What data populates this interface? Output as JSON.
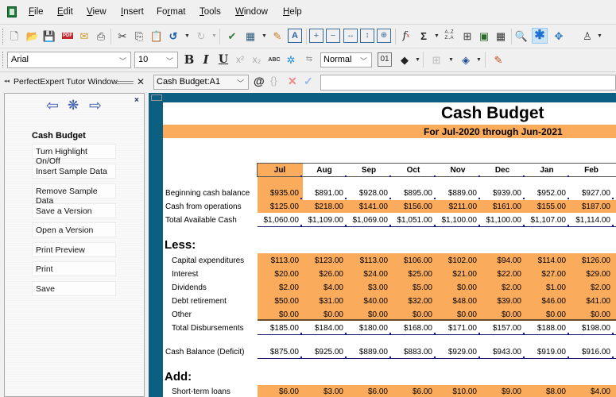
{
  "app": {
    "menu": [
      "File",
      "Edit",
      "View",
      "Insert",
      "Format",
      "Tools",
      "Window",
      "Help"
    ],
    "menu_mnemonic_index": [
      0,
      0,
      0,
      0,
      2,
      0,
      0,
      0
    ]
  },
  "toolbar1": {
    "icons": [
      "new-document-icon",
      "open-folder-icon",
      "save-icon",
      "pdf-icon",
      "email-icon",
      "print-icon",
      "cut-icon",
      "copy-icon",
      "paste-icon",
      "undo-icon",
      "redo-icon",
      "spellcheck-icon",
      "chart-icon",
      "fill-picture-icon",
      "text-box-icon",
      "insert-row-icon",
      "delete-row-icon",
      "column-width-icon",
      "row-height-icon",
      "fit-icon",
      "function-icon",
      "sum-icon",
      "sort-icon",
      "insert-table-icon",
      "grid-icon",
      "freeze-icon",
      "zoom-icon",
      "asterisk-icon",
      "navigate-icon",
      "outline-icon"
    ]
  },
  "toolbar2": {
    "font_name": "Arial",
    "font_size": "10",
    "bold": "B",
    "italic": "I",
    "underline": "U",
    "superscript": "x²",
    "subscript": "x₂",
    "style": "Normal"
  },
  "formula_bar": {
    "cell_ref": "Cash Budget:A1",
    "at_symbol": "@",
    "braces": "{}",
    "cancel": "✕",
    "accept": "✓",
    "formula_value": ""
  },
  "tutor": {
    "title": "PerfectExpert Tutor Window",
    "close": "×",
    "heading": "Cash Budget",
    "buttons": [
      "Turn Highlight On/Off",
      "Insert Sample Data",
      "Remove Sample Data",
      "Save a Version",
      "Open a Version",
      "Print Preview",
      "Print",
      "Save"
    ]
  },
  "sheet": {
    "title": "Cash Budget",
    "subtitle": "For Jul-2020 through Jun-2021",
    "months": [
      "Jul",
      "Aug",
      "Sep",
      "Oct",
      "Nov",
      "Dec",
      "Jan",
      "Feb"
    ],
    "sections": {
      "less": "Less:",
      "add": "Add:"
    },
    "rows": [
      {
        "label": "Beginning cash balance",
        "values": [
          "$935.00",
          "$891.00",
          "$928.00",
          "$895.00",
          "$889.00",
          "$939.00",
          "$952.00",
          "$927.00"
        ]
      },
      {
        "label": "Cash from operations",
        "values": [
          "$125.00",
          "$218.00",
          "$141.00",
          "$156.00",
          "$211.00",
          "$161.00",
          "$155.00",
          "$187.00"
        ]
      },
      {
        "label": "Total Available Cash",
        "values": [
          "$1,060.00",
          "$1,109.00",
          "$1,069.00",
          "$1,051.00",
          "$1,100.00",
          "$1,100.00",
          "$1,107.00",
          "$1,114.00"
        ]
      },
      {
        "label": "Capital expenditures",
        "values": [
          "$113.00",
          "$123.00",
          "$113.00",
          "$106.00",
          "$102.00",
          "$94.00",
          "$114.00",
          "$126.00"
        ]
      },
      {
        "label": "Interest",
        "values": [
          "$20.00",
          "$26.00",
          "$24.00",
          "$25.00",
          "$21.00",
          "$22.00",
          "$27.00",
          "$29.00"
        ]
      },
      {
        "label": "Dividends",
        "values": [
          "$2.00",
          "$4.00",
          "$3.00",
          "$5.00",
          "$0.00",
          "$2.00",
          "$1.00",
          "$2.00"
        ]
      },
      {
        "label": "Debt retirement",
        "values": [
          "$50.00",
          "$31.00",
          "$40.00",
          "$32.00",
          "$48.00",
          "$39.00",
          "$46.00",
          "$41.00"
        ]
      },
      {
        "label": "Other",
        "values": [
          "$0.00",
          "$0.00",
          "$0.00",
          "$0.00",
          "$0.00",
          "$0.00",
          "$0.00",
          "$0.00"
        ]
      },
      {
        "label": "Total Disbursements",
        "values": [
          "$185.00",
          "$184.00",
          "$180.00",
          "$168.00",
          "$171.00",
          "$157.00",
          "$188.00",
          "$198.00"
        ]
      },
      {
        "label": "Cash Balance (Deficit)",
        "values": [
          "$875.00",
          "$925.00",
          "$889.00",
          "$883.00",
          "$929.00",
          "$943.00",
          "$919.00",
          "$916.00"
        ]
      },
      {
        "label": "Short-term loans",
        "values": [
          "$6.00",
          "$3.00",
          "$6.00",
          "$6.00",
          "$10.00",
          "$9.00",
          "$8.00",
          "$4.00"
        ]
      }
    ]
  },
  "colors": {
    "accent_orange": "#fbab5c",
    "frame_blue": "#0c5f80"
  }
}
